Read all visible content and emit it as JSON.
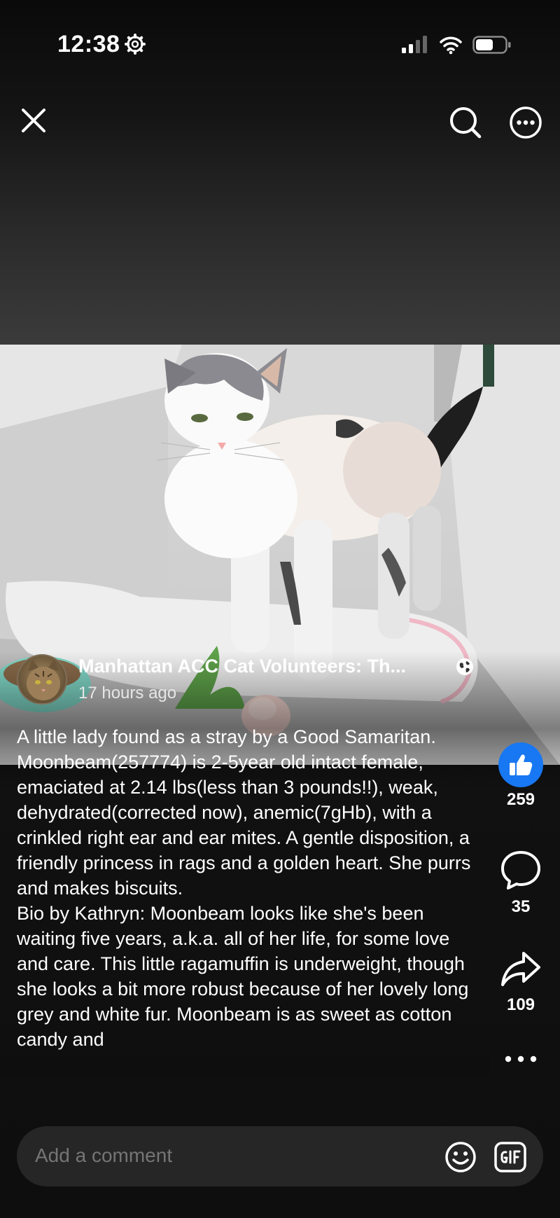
{
  "status_bar": {
    "time": "12:38"
  },
  "post": {
    "author": "Manhattan ACC Cat Volunteers: Th...",
    "time_ago": "17 hours ago",
    "caption_paragraphs": [
      "A little lady found as a stray by a Good Samaritan. Moonbeam(257774) is 2-5year old intact female, emaciated at 2.14 lbs(less than 3 pounds!!), weak, dehydrated(corrected now), anemic(7gHb), with a crinkled right ear and ear mites. A gentle disposition, a friendly princess in rags and a golden heart. She purrs and makes biscuits.",
      "Bio by Kathryn: Moonbeam looks like she's been waiting five years, a.k.a. all of her life, for some love and care. This little ragamuffin is underweight, though she looks a bit more robust because of her lovely long grey and white fur. Moonbeam is as sweet as cotton candy and"
    ]
  },
  "actions": {
    "likes": "259",
    "comments": "35",
    "shares": "109"
  },
  "comment_bar": {
    "placeholder": "Add a comment"
  },
  "icons": {
    "close": "close-icon",
    "search": "search-icon",
    "more": "more-icon",
    "like": "like-icon",
    "comment": "comment-icon",
    "share": "share-icon",
    "emoji": "emoji-icon",
    "gif": "gif-icon"
  },
  "colors": {
    "like_blue": "#1877f2",
    "comment_bar_bg": "#262626"
  }
}
